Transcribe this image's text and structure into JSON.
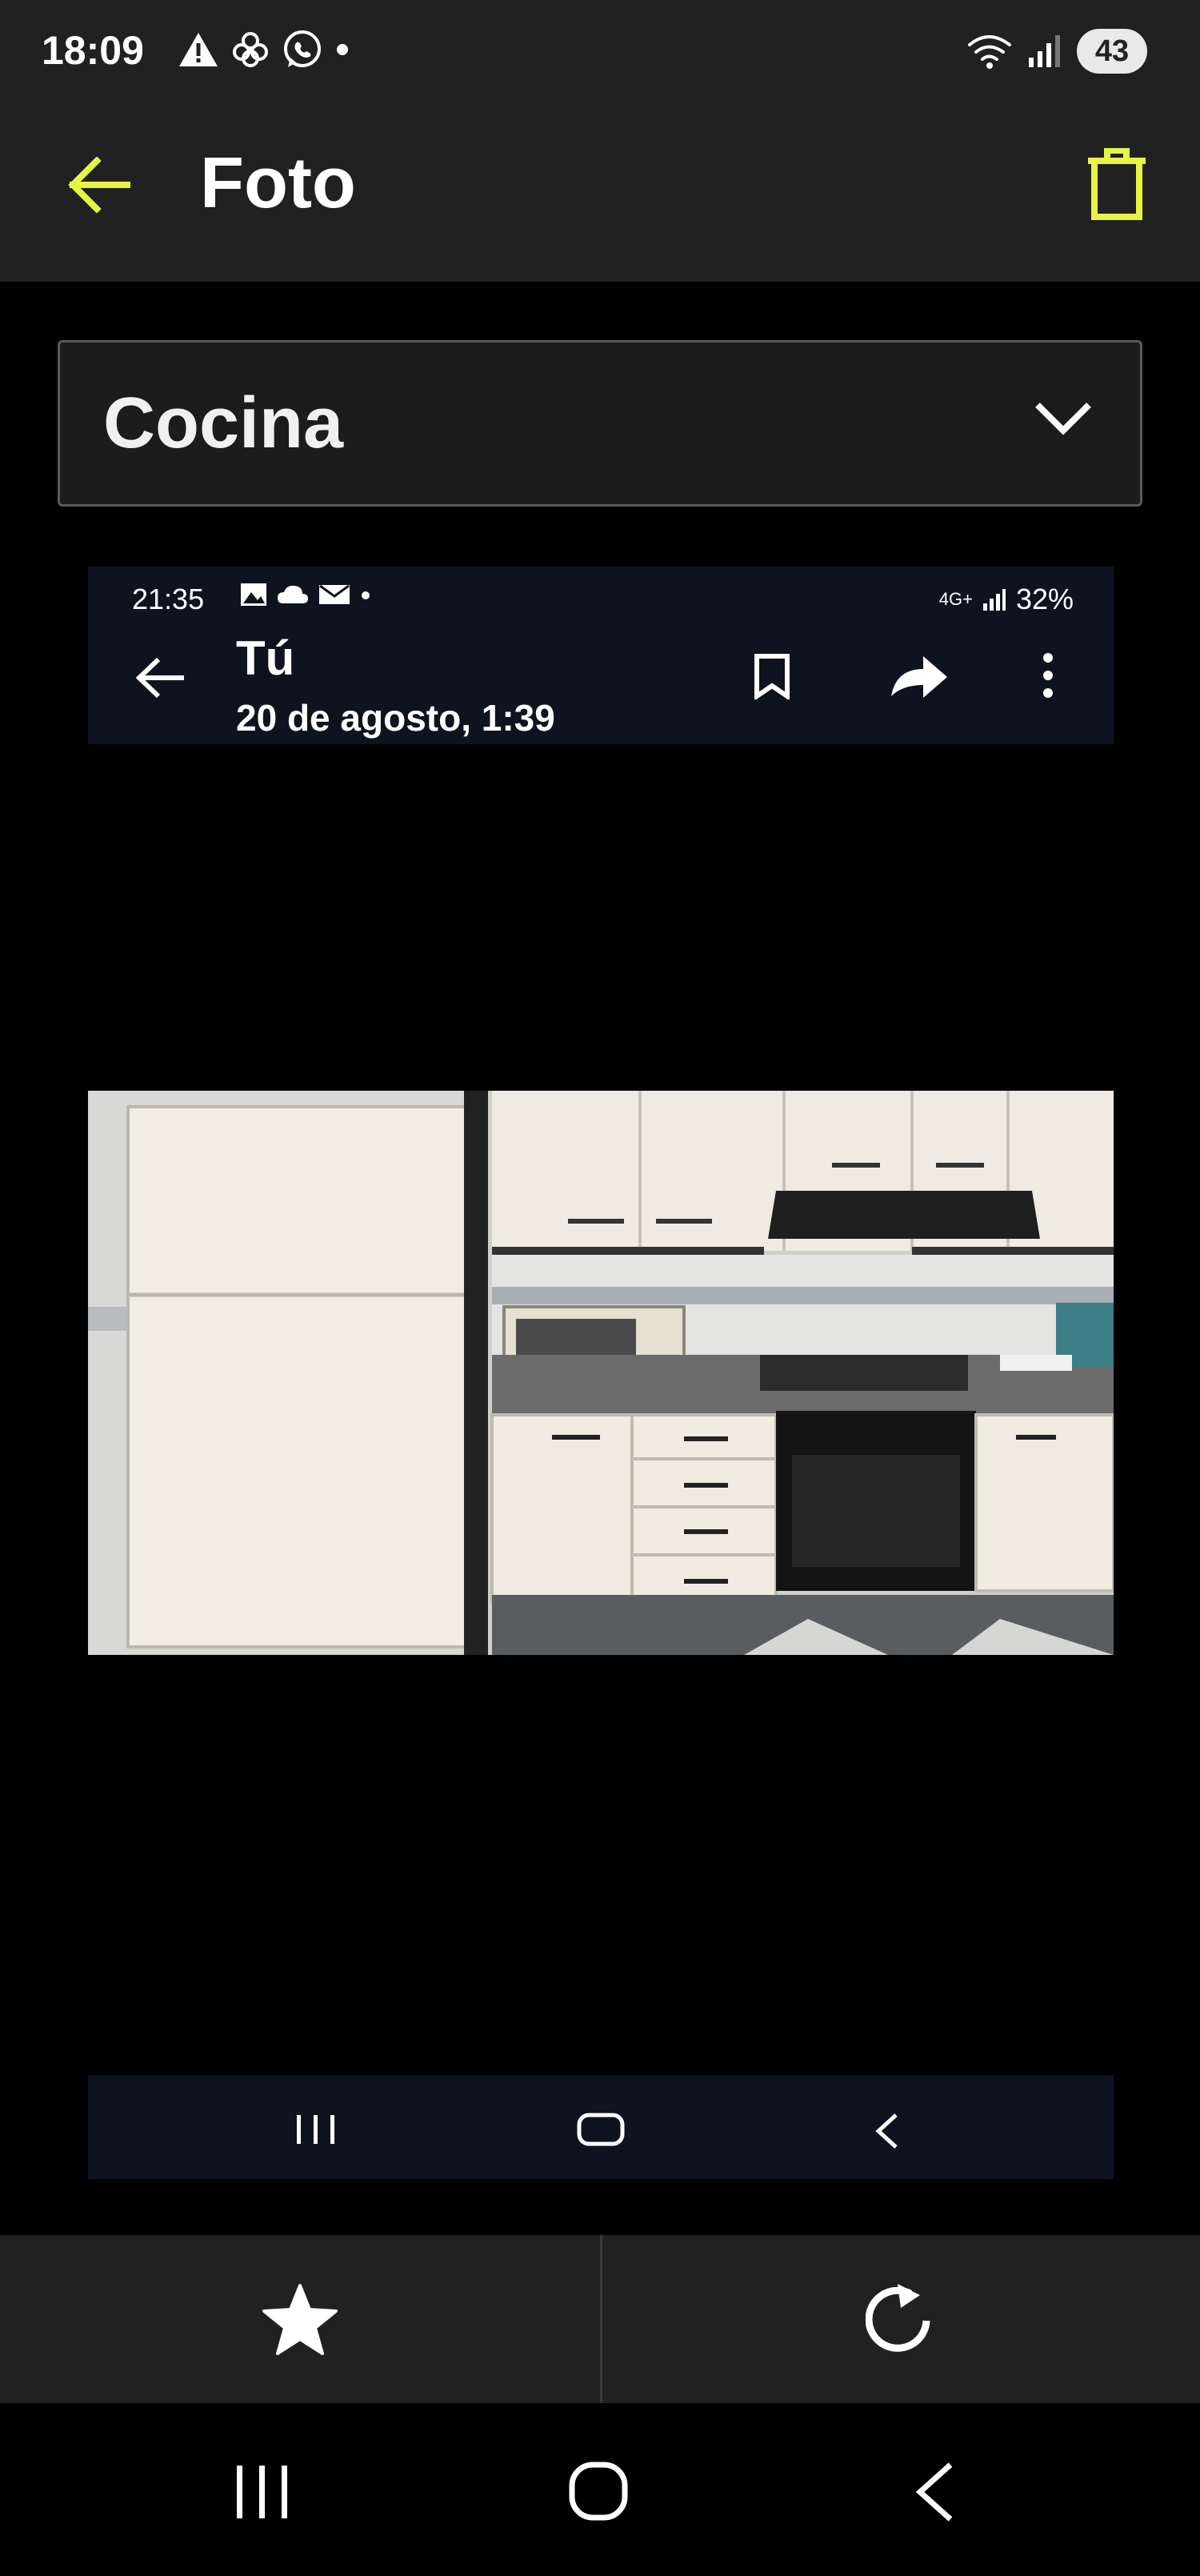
{
  "status_bar": {
    "time": "18:09",
    "battery": "43",
    "left_icons": [
      "warning-icon",
      "flower-icon",
      "whatsapp-icon",
      "dot-icon"
    ],
    "right_icons": [
      "wifi-icon",
      "signal-icon",
      "battery-icon"
    ]
  },
  "app_bar": {
    "title": "Foto",
    "back_icon": "arrow-left-icon",
    "delete_icon": "trash-icon",
    "accent_color": "#e6f542"
  },
  "category": {
    "selected": "Cocina",
    "icon": "chevron-down-icon"
  },
  "embedded_screenshot": {
    "time": "21:35",
    "network": "4G+",
    "battery": "32%",
    "sender": "Tú",
    "date": "20 de agosto, 1:39",
    "icons": [
      "back-arrow-icon",
      "bookmark-icon",
      "share-icon",
      "more-vertical-icon"
    ],
    "photo": "kitchen-photo"
  },
  "actions": {
    "favorite_icon": "star-icon",
    "rotate_icon": "rotate-icon"
  },
  "system_nav": {
    "icons": [
      "recent-apps-icon",
      "home-icon",
      "back-icon"
    ]
  }
}
